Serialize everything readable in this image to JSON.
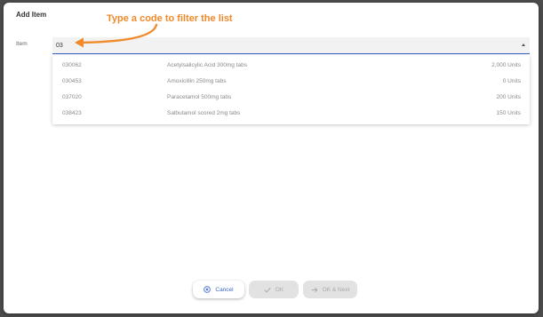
{
  "dialog": {
    "title": "Add Item",
    "item_label": "Item",
    "item_value": "03",
    "hint": "Type a code to filter the list"
  },
  "options": [
    {
      "code": "030062",
      "description": "Acetylsalicylic Acid 300mg tabs",
      "quantity": "2,000 Units"
    },
    {
      "code": "030453",
      "description": "Amoxicillin 250mg tabs",
      "quantity": "0 Units"
    },
    {
      "code": "037020",
      "description": "Paracetamol 500mg tabs",
      "quantity": "200 Units"
    },
    {
      "code": "038423",
      "description": "Salbutamol scored 2mg tabs",
      "quantity": "150 Units"
    }
  ],
  "buttons": {
    "cancel": "Cancel",
    "ok": "OK",
    "ok_next": "OK & Next"
  },
  "icons": {
    "cancel": "cancel-circle-icon",
    "ok": "check-icon",
    "ok_next": "arrow-right-icon",
    "dropdown": "caret-up-icon",
    "hint_arrow": "curved-arrow-icon"
  },
  "colors": {
    "accent": "#3b67c6",
    "hint": "#f08a2a",
    "disabled_bg": "#e2e2e2"
  }
}
